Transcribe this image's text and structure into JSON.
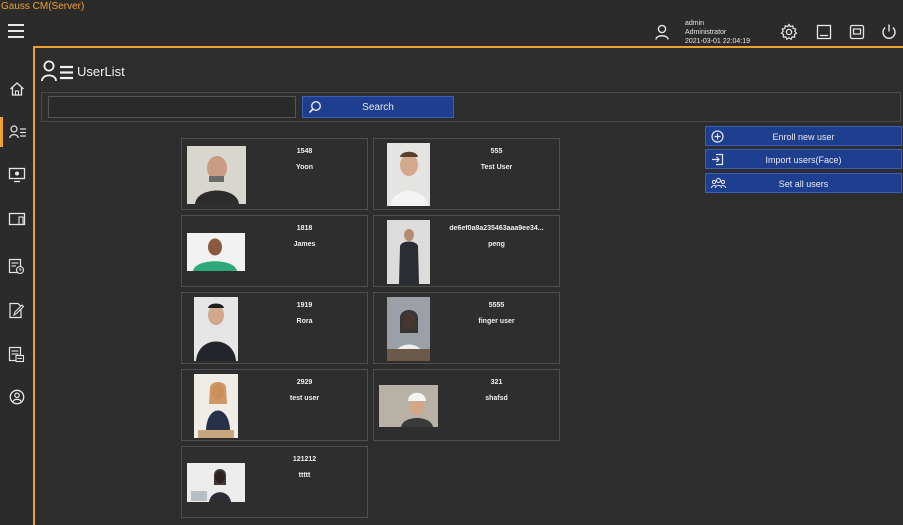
{
  "app": {
    "title": "Gauss CM(Server)"
  },
  "user": {
    "name": "admin",
    "role": "Administrator",
    "datetime": "2021-03-01 22:04:19"
  },
  "page": {
    "title": "UserList"
  },
  "search": {
    "placeholder": "",
    "value": "",
    "button_label": "Search"
  },
  "actions": {
    "enroll": "Enroll new user",
    "import": "Import users(Face)",
    "set_all": "Set all users"
  },
  "users": [
    {
      "id": "1548",
      "name": "Yoon"
    },
    {
      "id": "555",
      "name": "Test User"
    },
    {
      "id": "1818",
      "name": "James"
    },
    {
      "id": "de6ef0a8a235463aaa9ee34...",
      "name": "peng"
    },
    {
      "id": "1919",
      "name": "Rora"
    },
    {
      "id": "5555",
      "name": "finger user"
    },
    {
      "id": "2929",
      "name": "test user"
    },
    {
      "id": "321",
      "name": "shafsd"
    },
    {
      "id": "121212",
      "name": "ttttt"
    }
  ],
  "colors": {
    "accent": "#f0a030",
    "button": "#1e3f8f",
    "background": "#2b2b2b"
  }
}
